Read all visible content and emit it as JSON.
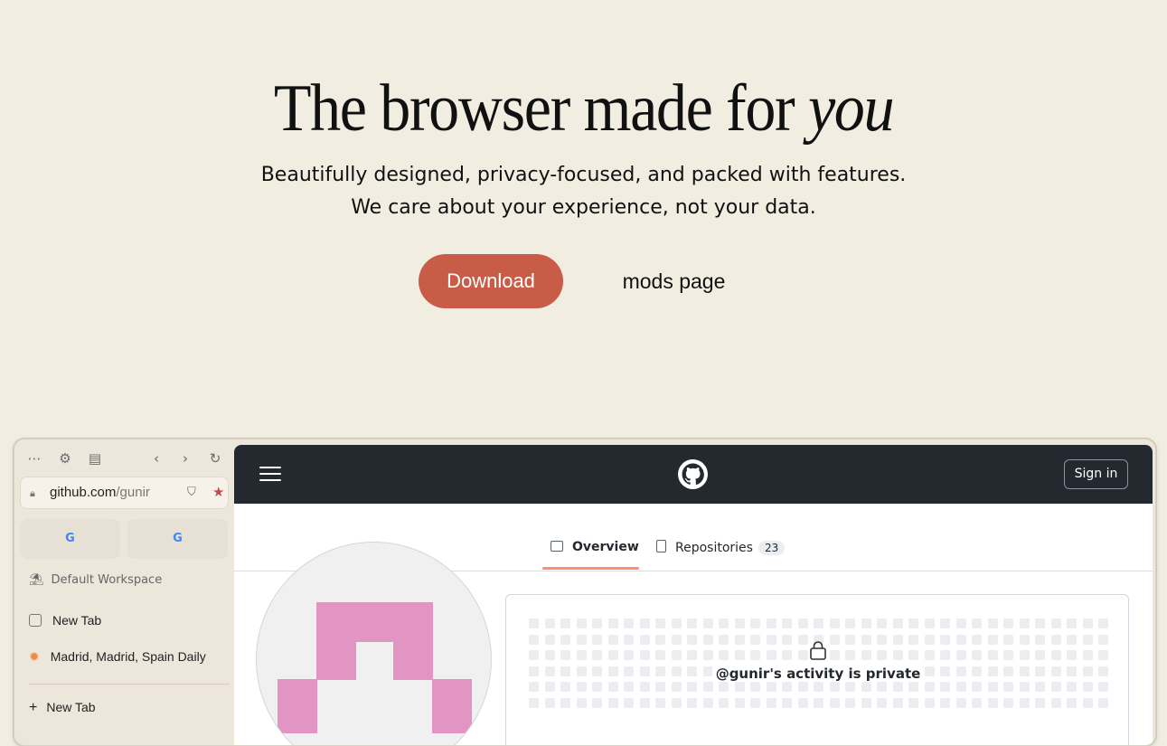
{
  "hero": {
    "title_main": "The browser made for ",
    "title_em": "you",
    "subtitle_line1": "Beautifully designed, privacy-focused, and packed with features.",
    "subtitle_line2": "We care about your experience, not your data.",
    "download_label": "Download",
    "mods_label": "mods page",
    "accent_color": "#c95c47"
  },
  "sidebar": {
    "url_host": "github.com",
    "url_path": "/gunir",
    "pinned": [
      "G",
      "G"
    ],
    "workspace": "Default Workspace",
    "tabs": [
      "New Tab",
      "Madrid, Madrid, Spain Daily"
    ],
    "new_tab_label": "New Tab"
  },
  "github": {
    "signin_label": "Sign in",
    "tab_overview": "Overview",
    "tab_repos": "Repositories",
    "repos_count": "23",
    "private_message": "@gunir's activity is private"
  }
}
